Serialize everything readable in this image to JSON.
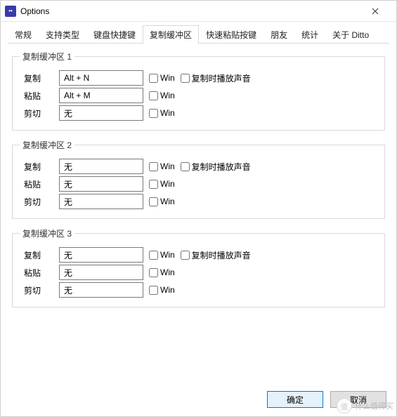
{
  "window": {
    "title": "Options"
  },
  "tabs": {
    "0": "常规",
    "1": "支持类型",
    "2": "键盘快捷键",
    "3": "复制缓冲区",
    "4": "快速粘贴按键",
    "5": "朋友",
    "6": "统计",
    "7": "关于 Ditto"
  },
  "labels": {
    "copy": "复制",
    "paste": "粘贴",
    "cut": "剪切",
    "win": "Win",
    "playSound": "复制时播放声音"
  },
  "groups": {
    "b1": {
      "legend": "复制缓冲区 1",
      "copy": "Alt + N",
      "paste": "Alt + M",
      "cut": "无"
    },
    "b2": {
      "legend": "复制缓冲区 2",
      "copy": "无",
      "paste": "无",
      "cut": "无"
    },
    "b3": {
      "legend": "复制缓冲区 3",
      "copy": "无",
      "paste": "无",
      "cut": "无"
    }
  },
  "buttons": {
    "ok": "确定",
    "cancel": "取消"
  },
  "watermark": {
    "seal": "值",
    "text": "什么值得买"
  }
}
